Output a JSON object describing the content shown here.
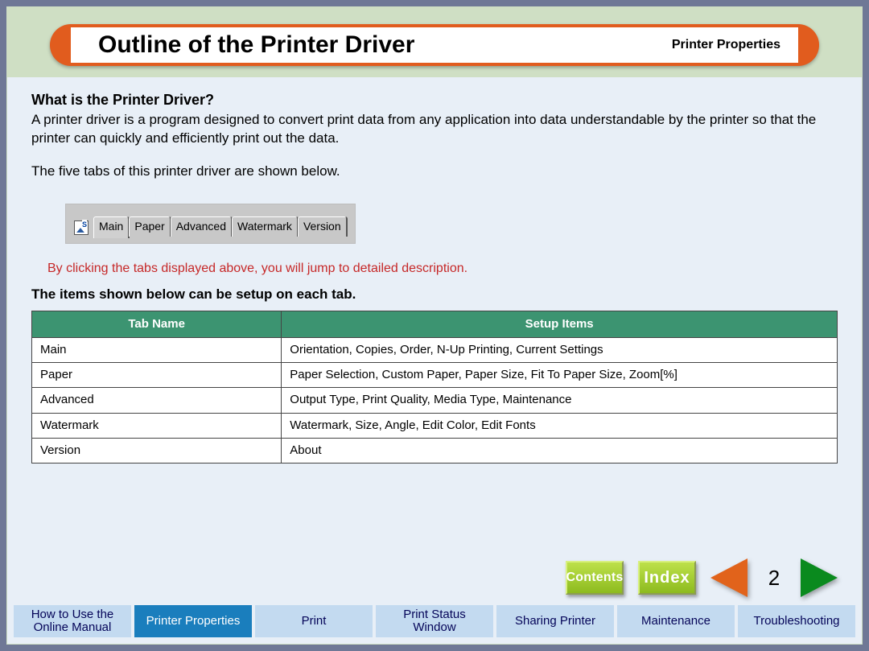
{
  "header": {
    "title": "Outline of the Printer Driver",
    "section": "Printer Properties"
  },
  "body": {
    "h2": "What is the Printer Driver?",
    "intro": "A printer driver is a program designed to convert print data from any application into data understandable by the printer so that the printer can quickly and efficiently print out the data.",
    "tabs_intro": "The five tabs of this printer driver are shown below.",
    "red_note": "By clicking the tabs displayed above, you will jump to detailed description.",
    "setup_heading": "The items shown below can be setup on each tab."
  },
  "driver_tabs": {
    "items": [
      {
        "label": "Main"
      },
      {
        "label": "Paper"
      },
      {
        "label": "Advanced"
      },
      {
        "label": "Watermark"
      },
      {
        "label": "Version"
      }
    ]
  },
  "table": {
    "col1": "Tab Name",
    "col2": "Setup Items",
    "rows": [
      {
        "name": "Main",
        "items": "Orientation, Copies, Order, N-Up Printing, Current Settings"
      },
      {
        "name": "Paper",
        "items": "Paper Selection, Custom Paper, Paper Size, Fit To Paper Size, Zoom[%]"
      },
      {
        "name": "Advanced",
        "items": "Output Type, Print Quality, Media Type, Maintenance"
      },
      {
        "name": "Watermark",
        "items": "Watermark, Size, Angle, Edit Color, Edit Fonts"
      },
      {
        "name": "Version",
        "items": "About"
      }
    ]
  },
  "nav": {
    "contents": "Contents",
    "index": "Index",
    "page": "2"
  },
  "bottom_tabs": {
    "items": [
      {
        "label": "How to Use the\nOnline Manual"
      },
      {
        "label": "Printer Properties"
      },
      {
        "label": "Print"
      },
      {
        "label": "Print Status\nWindow"
      },
      {
        "label": "Sharing Printer"
      },
      {
        "label": "Maintenance"
      },
      {
        "label": "Troubleshooting"
      }
    ],
    "active_index": 1
  }
}
